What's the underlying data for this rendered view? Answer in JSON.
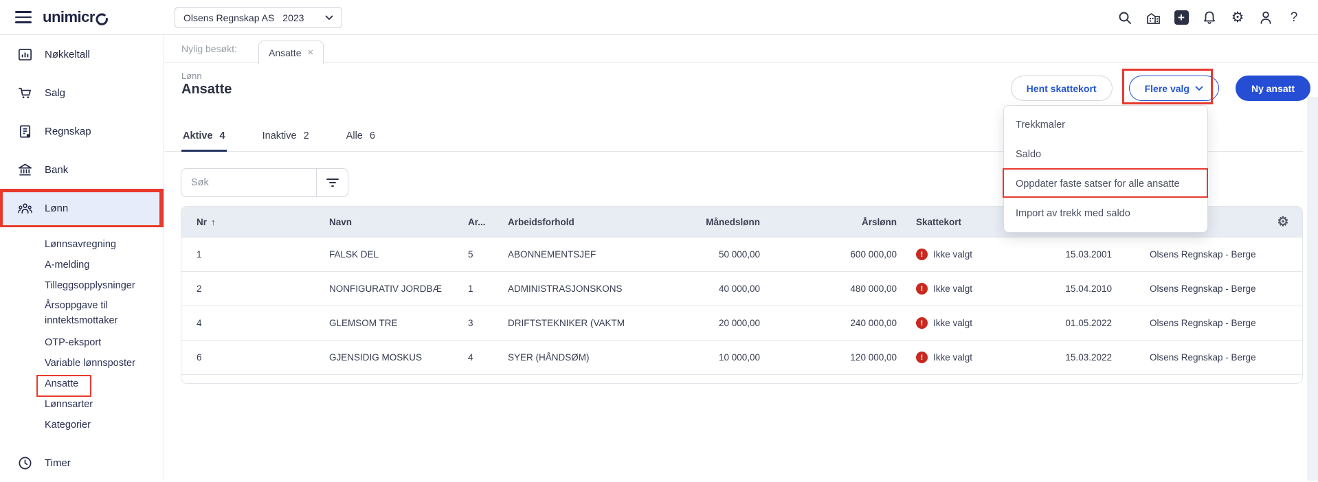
{
  "topbar": {
    "logo_text": "unimicr",
    "company_selector": {
      "company": "Olsens Regnskap AS",
      "year": "2023"
    },
    "icons": [
      "search-icon",
      "buildings-icon",
      "plus-icon",
      "bell-icon",
      "gear-icon",
      "user-icon",
      "help-icon"
    ],
    "plus_glyph": "+",
    "help_glyph": "?",
    "gear_glyph": "⚙"
  },
  "sidebar": {
    "items": [
      {
        "label": "Nøkkeltall",
        "icon": "bar-chart-icon"
      },
      {
        "label": "Salg",
        "icon": "cart-icon"
      },
      {
        "label": "Regnskap",
        "icon": "ledger-icon"
      },
      {
        "label": "Bank",
        "icon": "bank-icon"
      },
      {
        "label": "Lønn",
        "icon": "people-icon",
        "active": true
      },
      {
        "label": "Timer",
        "icon": "clock-icon"
      }
    ],
    "lonn_submenu": [
      "Lønnsavregning",
      "A-melding",
      "Tilleggsopplysninger",
      "Årsoppgave til inntektsmottaker",
      "OTP-eksport",
      "Variable lønnsposter",
      "Ansatte",
      "Lønnsarter",
      "Kategorier"
    ]
  },
  "tabstrip": {
    "label": "Nylig besøkt:",
    "tab": "Ansatte",
    "close_glyph": "×"
  },
  "page_header": {
    "breadcrumb": "Lønn",
    "title": "Ansatte",
    "buttons": {
      "hent_skattekort": "Hent skattekort",
      "flere_valg": "Flere valg",
      "ny_ansatt": "Ny ansatt"
    }
  },
  "dropdown_menu": {
    "items": [
      "Trekkmaler",
      "Saldo",
      "Oppdater faste satser for alle ansatte",
      "Import av trekk med saldo"
    ],
    "highlighted_item": "Oppdater faste satser for alle ansatte"
  },
  "filter_tabs": [
    {
      "label": "Aktive",
      "count": "4",
      "active": true
    },
    {
      "label": "Inaktive",
      "count": "2",
      "active": false
    },
    {
      "label": "Alle",
      "count": "6",
      "active": false
    }
  ],
  "search": {
    "placeholder": "Søk"
  },
  "table": {
    "columns": [
      "Nr",
      "Navn",
      "Ar...",
      "Arbeidsforhold",
      "Månedslønn",
      "Årslønn",
      "Skattekort"
    ],
    "sort_column": "Nr",
    "sort_glyph": "↑",
    "badge_glyph": "!",
    "rows": [
      {
        "nr": "1",
        "navn": "FALSK DEL",
        "ar": "5",
        "arbeidsforhold": "ABONNEMENTSJEF",
        "manedslonn": "50 000,00",
        "arslonn": "600 000,00",
        "skattekort": "Ikke valgt",
        "dato": "15.03.2001",
        "selskap": "Olsens Regnskap - Berge"
      },
      {
        "nr": "2",
        "navn": "NONFIGURATIV JORDBÆ",
        "ar": "1",
        "arbeidsforhold": "ADMINISTRASJONSKONS",
        "manedslonn": "40 000,00",
        "arslonn": "480 000,00",
        "skattekort": "Ikke valgt",
        "dato": "15.04.2010",
        "selskap": "Olsens Regnskap - Berge"
      },
      {
        "nr": "4",
        "navn": "GLEMSOM TRE",
        "ar": "3",
        "arbeidsforhold": "DRIFTSTEKNIKER (VAKTM",
        "manedslonn": "20 000,00",
        "arslonn": "240 000,00",
        "skattekort": "Ikke valgt",
        "dato": "01.05.2022",
        "selskap": "Olsens Regnskap - Berge"
      },
      {
        "nr": "6",
        "navn": "GJENSIDIG MOSKUS",
        "ar": "4",
        "arbeidsforhold": "SYER (HÅNDSØM)",
        "manedslonn": "10 000,00",
        "arslonn": "120 000,00",
        "skattekort": "Ikke valgt",
        "dato": "15.03.2022",
        "selskap": "Olsens Regnskap - Berge"
      }
    ]
  },
  "colors": {
    "accent_blue": "#254ED4",
    "annotation_red": "#E8392C",
    "badge_red": "#C9291F",
    "brand_navy": "#232A47"
  }
}
